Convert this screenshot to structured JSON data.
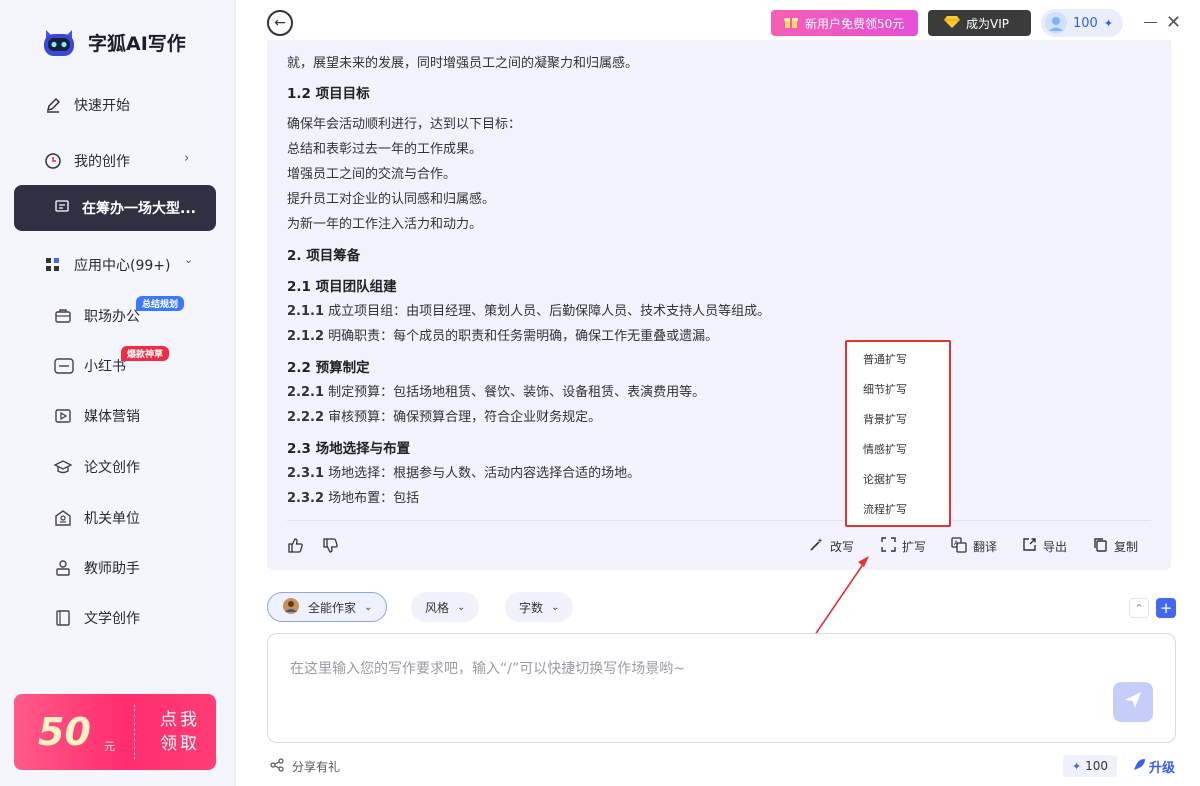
{
  "app": {
    "title": "字狐AI写作"
  },
  "sidebar": {
    "quick_start": "快速开始",
    "my_creation": "我的创作",
    "active_doc": "在筹办一场大型...",
    "app_center": "应用中心(99+)",
    "apps": [
      {
        "label": "职场办公",
        "badge": "总结规划"
      },
      {
        "label": "小红书",
        "badge": "爆款神草"
      },
      {
        "label": "媒体营销"
      },
      {
        "label": "论文创作"
      },
      {
        "label": "机关单位"
      },
      {
        "label": "教师助手"
      },
      {
        "label": "文学创作"
      }
    ],
    "promo": {
      "amount": "50",
      "unit": "元",
      "cta_line1": "点我",
      "cta_line2": "领取"
    }
  },
  "topbar": {
    "new_user": "新用户免费领50元",
    "vip": "成为VIP",
    "points": "100"
  },
  "document": {
    "line0": "就，展望未来的发展，同时增强员工之间的凝聚力和归属感。",
    "h_1_2": "1.2 项目目标",
    "p1": "确保年会活动顺利进行，达到以下目标：",
    "p2": "总结和表彰过去一年的工作成果。",
    "p3": "增强员工之间的交流与合作。",
    "p4": "提升员工对企业的认同感和归属感。",
    "p5": "为新一年的工作注入活力和动力。",
    "h_2": "2. 项目筹备",
    "h_2_1": "2.1 项目团队组建",
    "n_2_1_1": "2.1.1",
    "t_2_1_1": " 成立项目组：由项目经理、策划人员、后勤保障人员、技术支持人员等组成。",
    "n_2_1_2": "2.1.2",
    "t_2_1_2": " 明确职责：每个成员的职责和任务需明确，确保工作无重叠或遗漏。",
    "h_2_2": "2.2 预算制定",
    "n_2_2_1": "2.2.1",
    "t_2_2_1": " 制定预算：包括场地租赁、餐饮、装饰、设备租赁、表演费用等。",
    "n_2_2_2": "2.2.2",
    "t_2_2_2": " 审核预算：确保预算合理，符合企业财务规定。",
    "h_2_3": "2.3 场地选择与布置",
    "n_2_3_1": "2.3.1",
    "t_2_3_1": " 场地选择：根据参与人数、活动内容选择合适的场地。",
    "n_2_3_2": "2.3.2",
    "t_2_3_2": " 场地布置：包括"
  },
  "actions": {
    "rewrite": "改写",
    "expand": "扩写",
    "translate": "翻译",
    "export": "导出",
    "copy": "复制"
  },
  "expand_menu": [
    "普通扩写",
    "细节扩写",
    "背景扩写",
    "情感扩写",
    "论据扩写",
    "流程扩写"
  ],
  "tools": {
    "writer": "全能作家",
    "style": "风格",
    "word_count": "字数"
  },
  "input": {
    "placeholder": "在这里输入您的写作要求吧，输入“/”可以快捷切换写作场景哟~"
  },
  "footer": {
    "share": "分享有礼",
    "points": "100",
    "upgrade": "升级"
  },
  "colors": {
    "accent": "#4466f0",
    "sidebar_active": "#2f3142",
    "highlight_red": "#e2332f"
  }
}
